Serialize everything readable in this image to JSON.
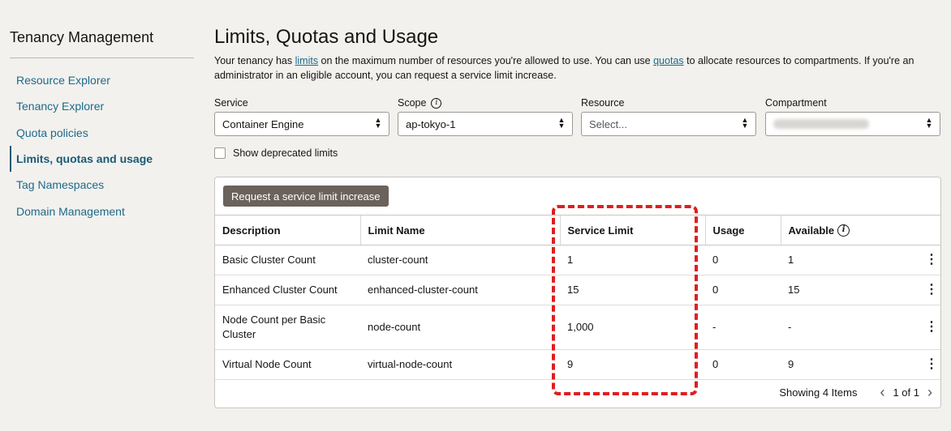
{
  "sidebar": {
    "title": "Tenancy Management",
    "items": [
      {
        "label": "Resource Explorer"
      },
      {
        "label": "Tenancy Explorer"
      },
      {
        "label": "Quota policies"
      },
      {
        "label": "Limits, quotas and usage"
      },
      {
        "label": "Tag Namespaces"
      },
      {
        "label": "Domain Management"
      }
    ]
  },
  "page": {
    "title": "Limits, Quotas and Usage",
    "intro_part1": "Your tenancy has ",
    "intro_link1": "limits",
    "intro_part2": " on the maximum number of resources you're allowed to use. You can use ",
    "intro_link2": "quotas",
    "intro_part3": " to allocate resources to compartments. If you're an administrator in an eligible account, you can request a service limit increase."
  },
  "filters": {
    "service": {
      "label": "Service",
      "value": "Container Engine"
    },
    "scope": {
      "label": "Scope",
      "value": "ap-tokyo-1"
    },
    "resource": {
      "label": "Resource",
      "value": "Select..."
    },
    "compartment": {
      "label": "Compartment"
    }
  },
  "deprecated_label": "Show deprecated limits",
  "request_button": "Request a service limit increase",
  "table": {
    "headers": [
      "Description",
      "Limit Name",
      "Service Limit",
      "Usage",
      "Available"
    ],
    "rows": [
      {
        "description": "Basic Cluster Count",
        "limit_name": "cluster-count",
        "service_limit": "1",
        "usage": "0",
        "available": "1"
      },
      {
        "description": "Enhanced Cluster Count",
        "limit_name": "enhanced-cluster-count",
        "service_limit": "15",
        "usage": "0",
        "available": "15"
      },
      {
        "description": "Node Count per Basic Cluster",
        "limit_name": "node-count",
        "service_limit": "1,000",
        "usage": "-",
        "available": "-"
      },
      {
        "description": "Virtual Node Count",
        "limit_name": "virtual-node-count",
        "service_limit": "9",
        "usage": "0",
        "available": "9"
      }
    ]
  },
  "footer": {
    "showing": "Showing 4 Items",
    "page": "1 of 1"
  },
  "colors": {
    "link": "#1e6a8a",
    "button": "#6a625b",
    "highlight": "#e01e1e"
  }
}
